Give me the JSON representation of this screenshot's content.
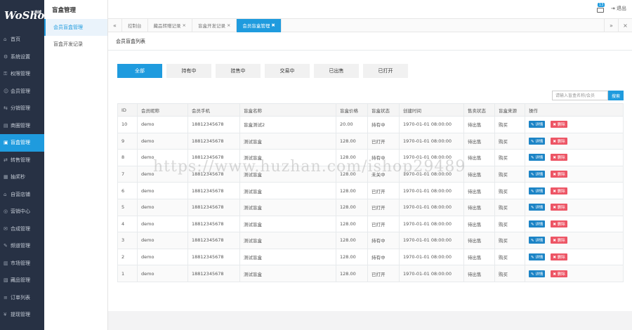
{
  "brand": {
    "logo": "WoShop",
    "sub": "商城"
  },
  "sidebar": {
    "items": [
      {
        "icon": "⌂",
        "label": "首页"
      },
      {
        "icon": "⚙",
        "label": "系统设置"
      },
      {
        "icon": "⚿",
        "label": "权限管理"
      },
      {
        "icon": "☺",
        "label": "会员管理"
      },
      {
        "icon": "⇆",
        "label": "分销管理"
      },
      {
        "icon": "▤",
        "label": "商圈管理"
      },
      {
        "icon": "▣",
        "label": "盲盒管理",
        "active": true
      },
      {
        "icon": "⇄",
        "label": "转售管理"
      },
      {
        "icon": "▦",
        "label": "抽奖秒"
      },
      {
        "icon": "⌂",
        "label": "自营店铺"
      },
      {
        "icon": "◎",
        "label": "营销中心"
      },
      {
        "icon": "✉",
        "label": "合成管理"
      },
      {
        "icon": "✎",
        "label": "频道管理"
      },
      {
        "icon": "▥",
        "label": "市场管理"
      },
      {
        "icon": "▧",
        "label": "藏品管理"
      },
      {
        "icon": "≡",
        "label": "订单列表"
      },
      {
        "icon": "¥",
        "label": "提现管理"
      }
    ]
  },
  "subnav": {
    "title": "盲盒管理",
    "items": [
      {
        "label": "会员盲盒管理",
        "active": true
      },
      {
        "label": "盲盒开发记录",
        "active": false
      }
    ]
  },
  "topbar": {
    "msg_count": "13",
    "logout": "退出"
  },
  "tabs": [
    {
      "label": "控制台",
      "closable": false,
      "active": false
    },
    {
      "label": "藏品转赠记录",
      "closable": true,
      "active": false
    },
    {
      "label": "盲盒开发记录",
      "closable": true,
      "active": false
    },
    {
      "label": "会员盲盒管理",
      "closable": true,
      "active": true
    }
  ],
  "panel": {
    "title": "会员盲盒列表"
  },
  "filters": [
    {
      "label": "全部",
      "active": true
    },
    {
      "label": "持有中",
      "active": false
    },
    {
      "label": "挂售中",
      "active": false
    },
    {
      "label": "交易中",
      "active": false
    },
    {
      "label": "已出售",
      "active": false
    },
    {
      "label": "已打开",
      "active": false
    }
  ],
  "search": {
    "placeholder": "请输入盲盒名称/会员",
    "button": "搜索"
  },
  "table": {
    "columns": [
      "ID",
      "会员昵称",
      "会员手机",
      "盲盒名称",
      "盲盒价格",
      "盲盒状态",
      "创建时间",
      "售卖状态",
      "盲盒来源",
      "操作"
    ],
    "edit_label": "✎ 详情",
    "delete_label": "✖ 删除",
    "rows": [
      [
        "10",
        "demo",
        "18812345678",
        "盲盒测试2",
        "20.00",
        "持有中",
        "1970-01-01 08:00:00",
        "待出售",
        "购买"
      ],
      [
        "9",
        "demo",
        "18812345678",
        "测试盲盒",
        "128.00",
        "已打开",
        "1970-01-01 08:00:00",
        "待出售",
        "购买"
      ],
      [
        "8",
        "demo",
        "18812345678",
        "测试盲盒",
        "128.00",
        "持有中",
        "1970-01-01 08:00:00",
        "待出售",
        "购买"
      ],
      [
        "7",
        "demo",
        "18812345678",
        "测试盲盒",
        "128.00",
        "未关中",
        "1970-01-01 08:00:00",
        "待出售",
        "购买"
      ],
      [
        "6",
        "demo",
        "18812345678",
        "测试盲盒",
        "128.00",
        "已打开",
        "1970-01-01 08:00:00",
        "待出售",
        "购买"
      ],
      [
        "5",
        "demo",
        "18812345678",
        "测试盲盒",
        "128.00",
        "已打开",
        "1970-01-01 08:00:00",
        "待出售",
        "购买"
      ],
      [
        "4",
        "demo",
        "18812345678",
        "测试盲盒",
        "128.00",
        "已打开",
        "1970-01-01 08:00:00",
        "待出售",
        "购买"
      ],
      [
        "3",
        "demo",
        "18812345678",
        "测试盲盒",
        "128.00",
        "持有中",
        "1970-01-01 08:00:00",
        "待出售",
        "购买"
      ],
      [
        "2",
        "demo",
        "18812345678",
        "测试盲盒",
        "128.00",
        "持有中",
        "1970-01-01 08:00:00",
        "待出售",
        "购买"
      ],
      [
        "1",
        "demo",
        "18812345678",
        "测试盲盒",
        "128.00",
        "已打开",
        "1970-01-01 08:00:00",
        "待出售",
        "购买"
      ]
    ]
  },
  "watermark": "https://www.huzhan.com/ishop29489",
  "colors": {
    "accent": "#1f9bde",
    "sidebar_bg": "#273144",
    "edit": "#1c84c6",
    "delete": "#ed5565"
  }
}
